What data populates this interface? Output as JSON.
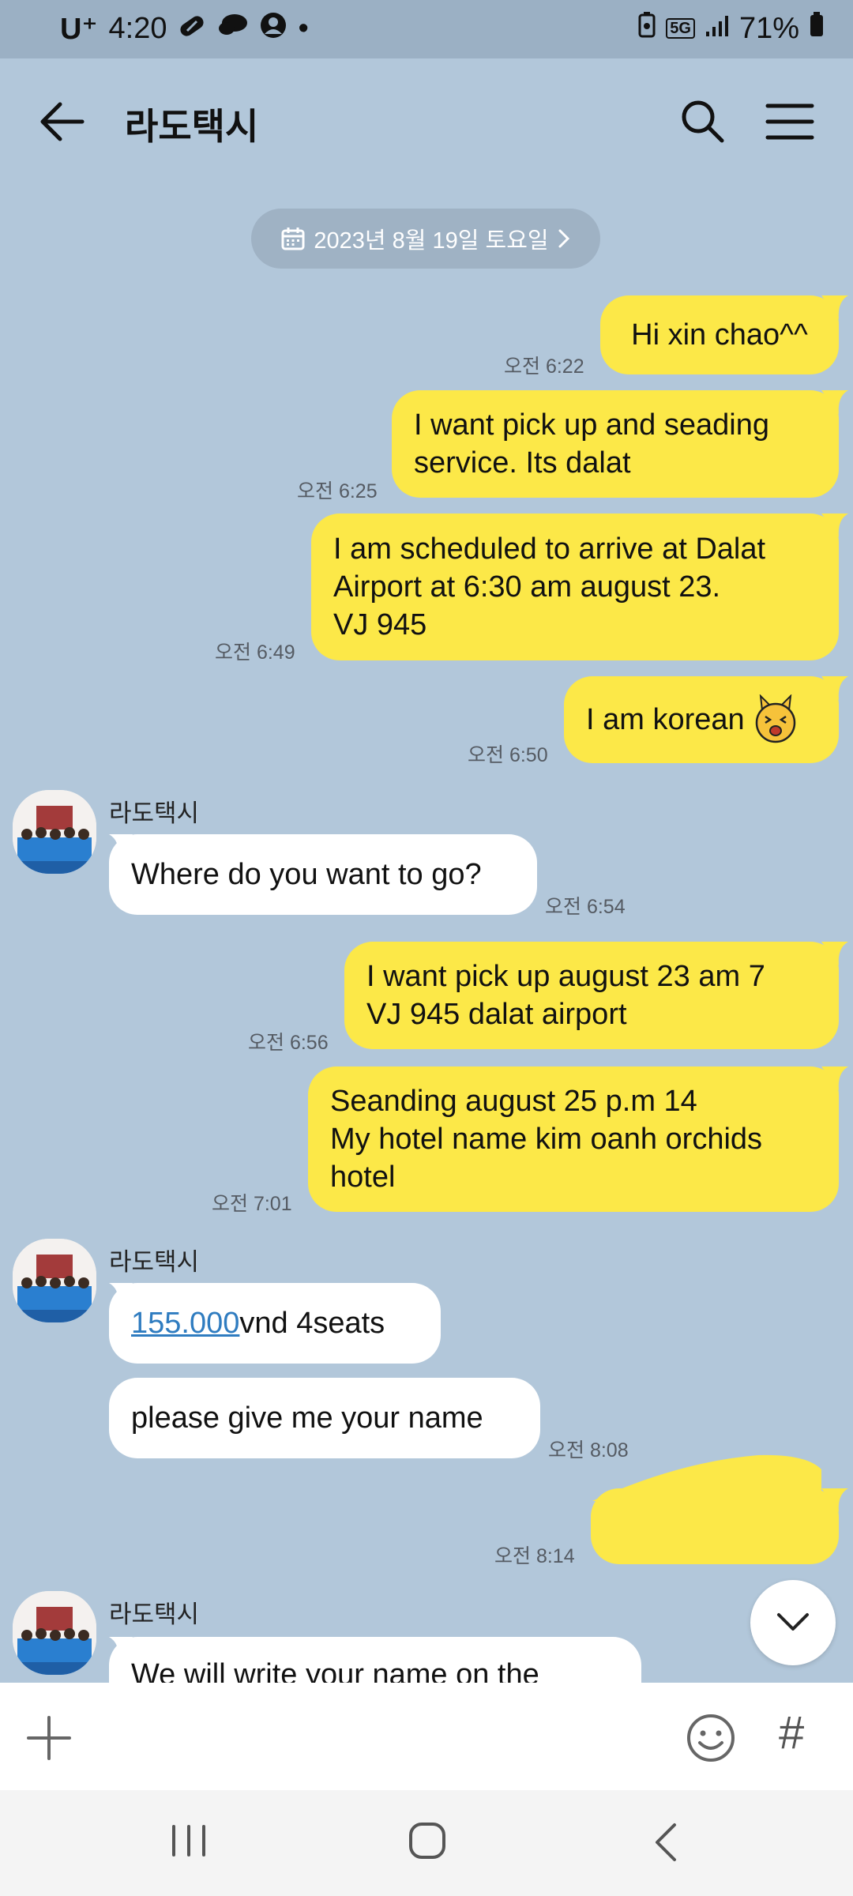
{
  "status_bar": {
    "carrier": "U⁺",
    "time": "4:20",
    "dot": "•",
    "battery": "71%",
    "network": "5G"
  },
  "header": {
    "title": "라도택시",
    "icons": [
      "back-arrow-icon",
      "search-icon",
      "menu-icon"
    ]
  },
  "date_divider": {
    "label": "2023년 8월 19일 토요일"
  },
  "messages": {
    "m1": {
      "text": "Hi xin chao^^",
      "time": "오전 6:22"
    },
    "m2": {
      "lines": [
        "I want pick up and seading",
        "service. Its dalat"
      ],
      "time": "오전 6:25"
    },
    "m3": {
      "lines": [
        "I am scheduled to arrive at Dalat",
        "Airport at 6:30 am  august 23.",
        "VJ 945"
      ],
      "time": "오전 6:49"
    },
    "m4": {
      "text": "I am korean",
      "emoticon": "cat-emoticon-icon",
      "time": "오전 6:50"
    },
    "m5": {
      "sender": "라도택시",
      "text": "Where do you want to go?",
      "time": "오전 6:54"
    },
    "m6": {
      "lines": [
        "I want pick up august 23 am 7",
        "VJ 945 dalat airport"
      ],
      "time": "오전 6:56"
    },
    "m7": {
      "lines": [
        "Seanding august 25 p.m 14",
        "My hotel name kim oanh orchids",
        "hotel"
      ],
      "time": "오전 7:01"
    },
    "m8": {
      "sender": "라도택시",
      "link": "155.000",
      "text": "vnd 4seats"
    },
    "m9": {
      "text": "please give me your name",
      "time": "오전 8:08"
    },
    "m10": {
      "time": "오전 8:14"
    },
    "m11": {
      "sender": "라도택시",
      "text": "We will write your name on the"
    }
  },
  "input_bar": {
    "hash": "#",
    "icons": [
      "plus-icon",
      "emoji-icon"
    ]
  },
  "colors": {
    "chat_bg": "#b2c7da",
    "outgoing": "#fce848",
    "incoming": "#ffffff",
    "link": "#2f7cc0"
  }
}
